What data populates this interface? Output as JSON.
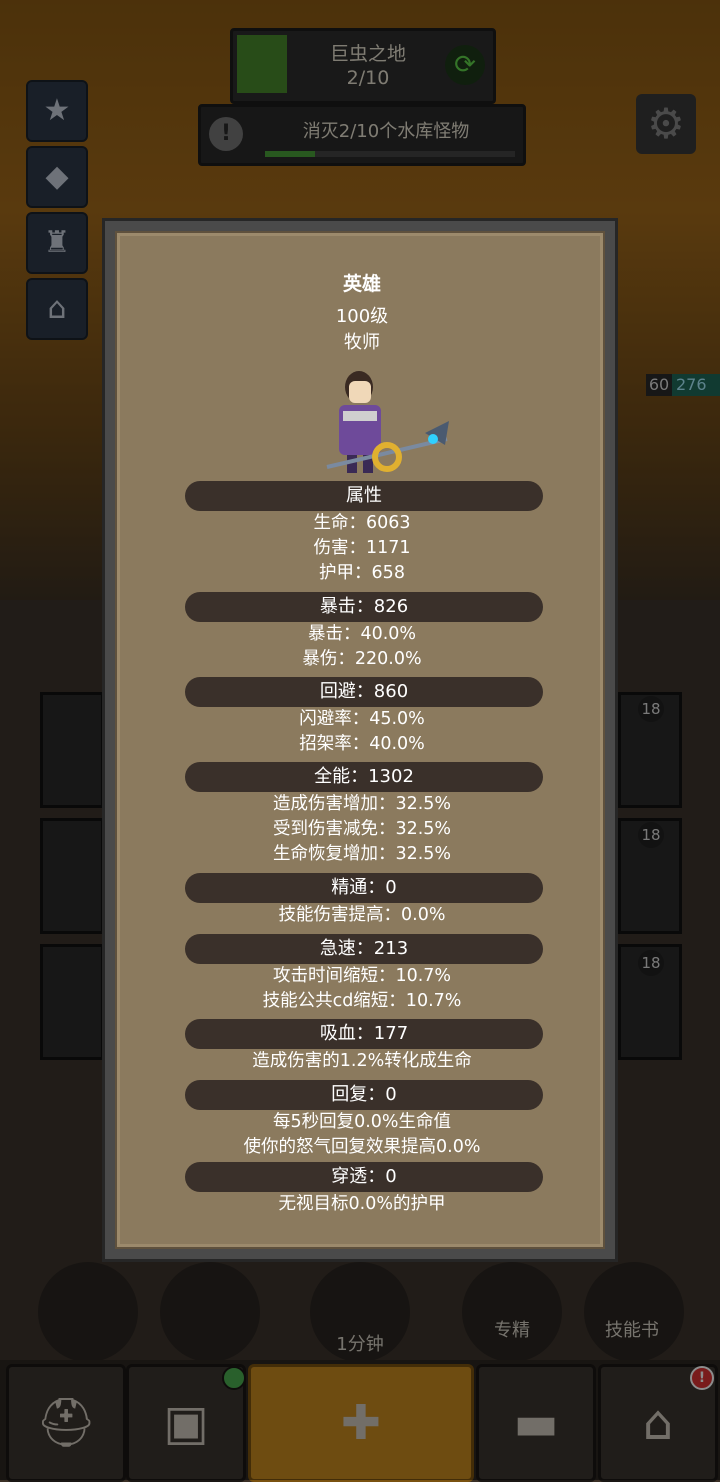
{
  "hud": {
    "zone_name": "巨虫之地",
    "zone_progress": "2/10",
    "quest_text": "消灭2/10个水库怪物",
    "enemy_level": "60",
    "enemy_hp": "276"
  },
  "hero": {
    "title": "英雄",
    "level": "100级",
    "class": "牧师"
  },
  "sections": [
    {
      "head": "属性",
      "lines": [
        "生命：6063",
        "伤害：1171",
        "护甲：658"
      ]
    },
    {
      "head": "暴击：826",
      "lines": [
        "暴击：40.0%",
        "暴伤：220.0%"
      ]
    },
    {
      "head": "回避：860",
      "lines": [
        "闪避率：45.0%",
        "招架率：40.0%"
      ]
    },
    {
      "head": "全能：1302",
      "lines": [
        "造成伤害增加：32.5%",
        "受到伤害减免：32.5%",
        "生命恢复增加：32.5%"
      ]
    },
    {
      "head": "精通：0",
      "lines": [
        "技能伤害提高：0.0%"
      ]
    },
    {
      "head": "急速：213",
      "lines": [
        "攻击时间缩短：10.7%",
        "技能公共cd缩短：10.7%"
      ]
    },
    {
      "head": "吸血：177",
      "lines": [
        "造成伤害的1.2%转化成生命"
      ]
    },
    {
      "head": "回复：0",
      "lines": [
        "每5秒回复0.0%生命值",
        "使你的怒气回复效果提高0.0%"
      ]
    },
    {
      "head": "穿透：0",
      "lines": [
        "无视目标0.0%的护甲"
      ]
    }
  ],
  "bottom": {
    "timer_label": "1分钟",
    "specialize_label": "专精",
    "skillbook_label": "技能书"
  },
  "tiles": {
    "level_1": "18",
    "level_2": "18",
    "level_3": "18"
  }
}
